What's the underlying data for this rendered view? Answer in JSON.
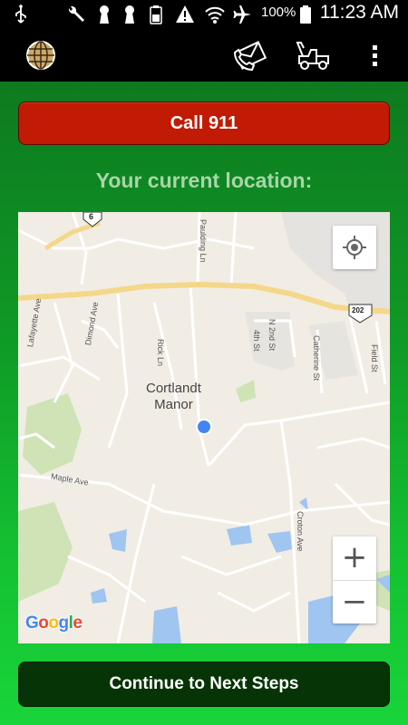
{
  "status_bar": {
    "battery_text": "100%",
    "time": "11:23 AM",
    "icons": [
      "usb-icon",
      "wrench-icon",
      "keyhole-icon",
      "keyhole-icon",
      "battery-saver-icon",
      "warning-icon",
      "wifi-icon",
      "airplane-icon",
      "battery-icon"
    ]
  },
  "app_bar": {
    "icons": [
      "globe-icon",
      "envelope-phone-icon",
      "tow-truck-icon",
      "overflow-menu-icon"
    ]
  },
  "call_button": {
    "label": "Call 911"
  },
  "location": {
    "title": "Your current location:"
  },
  "map": {
    "town_line1": "Cortlandt",
    "town_line2": "Manor",
    "route_6": "6",
    "route_202": "202",
    "streets": {
      "paulding": "Paulding Ln",
      "lafayette": "Lafayette Ave",
      "dimond": "Dimond Ave",
      "rick": "Rick Ln",
      "n2nd": "N 2nd St",
      "fourth": "4th St",
      "catherine": "Catherine St",
      "field": "Field St",
      "maple": "Maple Ave",
      "croton": "Croton Ave"
    },
    "zoom_in": "+",
    "zoom_out": "−",
    "logo": {
      "g": "G",
      "o1": "o",
      "o2": "o",
      "g2": "g",
      "l": "l",
      "e": "e"
    }
  },
  "continue_button": {
    "label": "Continue to Next Steps"
  }
}
